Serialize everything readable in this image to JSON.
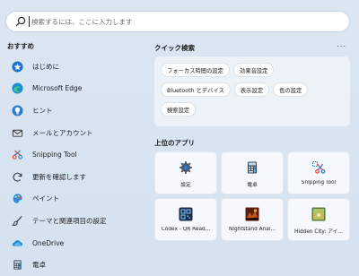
{
  "search": {
    "placeholder": "検索するには、ここに入力します",
    "icon": "search-icon"
  },
  "recommended": {
    "title": "おすすめ",
    "items": [
      {
        "label": "はじめに",
        "icon": "tips-star-icon"
      },
      {
        "label": "Microsoft Edge",
        "icon": "edge-icon"
      },
      {
        "label": "ヒント",
        "icon": "lightbulb-icon"
      },
      {
        "label": "メールとアカウント",
        "icon": "mail-icon"
      },
      {
        "label": "Snipping Tool",
        "icon": "snipping-tool-icon"
      },
      {
        "label": "更新を確認します",
        "icon": "update-icon"
      },
      {
        "label": "ペイント",
        "icon": "paint-icon"
      },
      {
        "label": "テーマと関連項目の設定",
        "icon": "brush-icon"
      },
      {
        "label": "OneDrive",
        "icon": "onedrive-icon"
      },
      {
        "label": "電卓",
        "icon": "calculator-icon"
      }
    ]
  },
  "quick_search": {
    "title": "クイック検索",
    "more_label": "...",
    "chips": [
      [
        "フォーカス時間の設定",
        "効果音設定"
      ],
      [
        "Bluetooth とデバイス",
        "表示設定",
        "色の設定"
      ],
      [
        "検索設定"
      ]
    ]
  },
  "top_apps": {
    "title": "上位のアプリ",
    "apps": [
      {
        "label": "設定",
        "icon": "settings-gear-icon"
      },
      {
        "label": "電卓",
        "icon": "calculator-icon"
      },
      {
        "label": "Snipping Tool",
        "icon": "snipping-tool-icon"
      },
      {
        "label": "Codex - QR Read...",
        "icon": "qr-reader-icon"
      },
      {
        "label": "Nightstand Anal...",
        "icon": "nightstand-icon"
      },
      {
        "label": "Hidden City: アイ...",
        "icon": "hidden-city-icon"
      }
    ]
  },
  "colors": {
    "background": "#d9e4f1",
    "accent": "#0067c0"
  }
}
